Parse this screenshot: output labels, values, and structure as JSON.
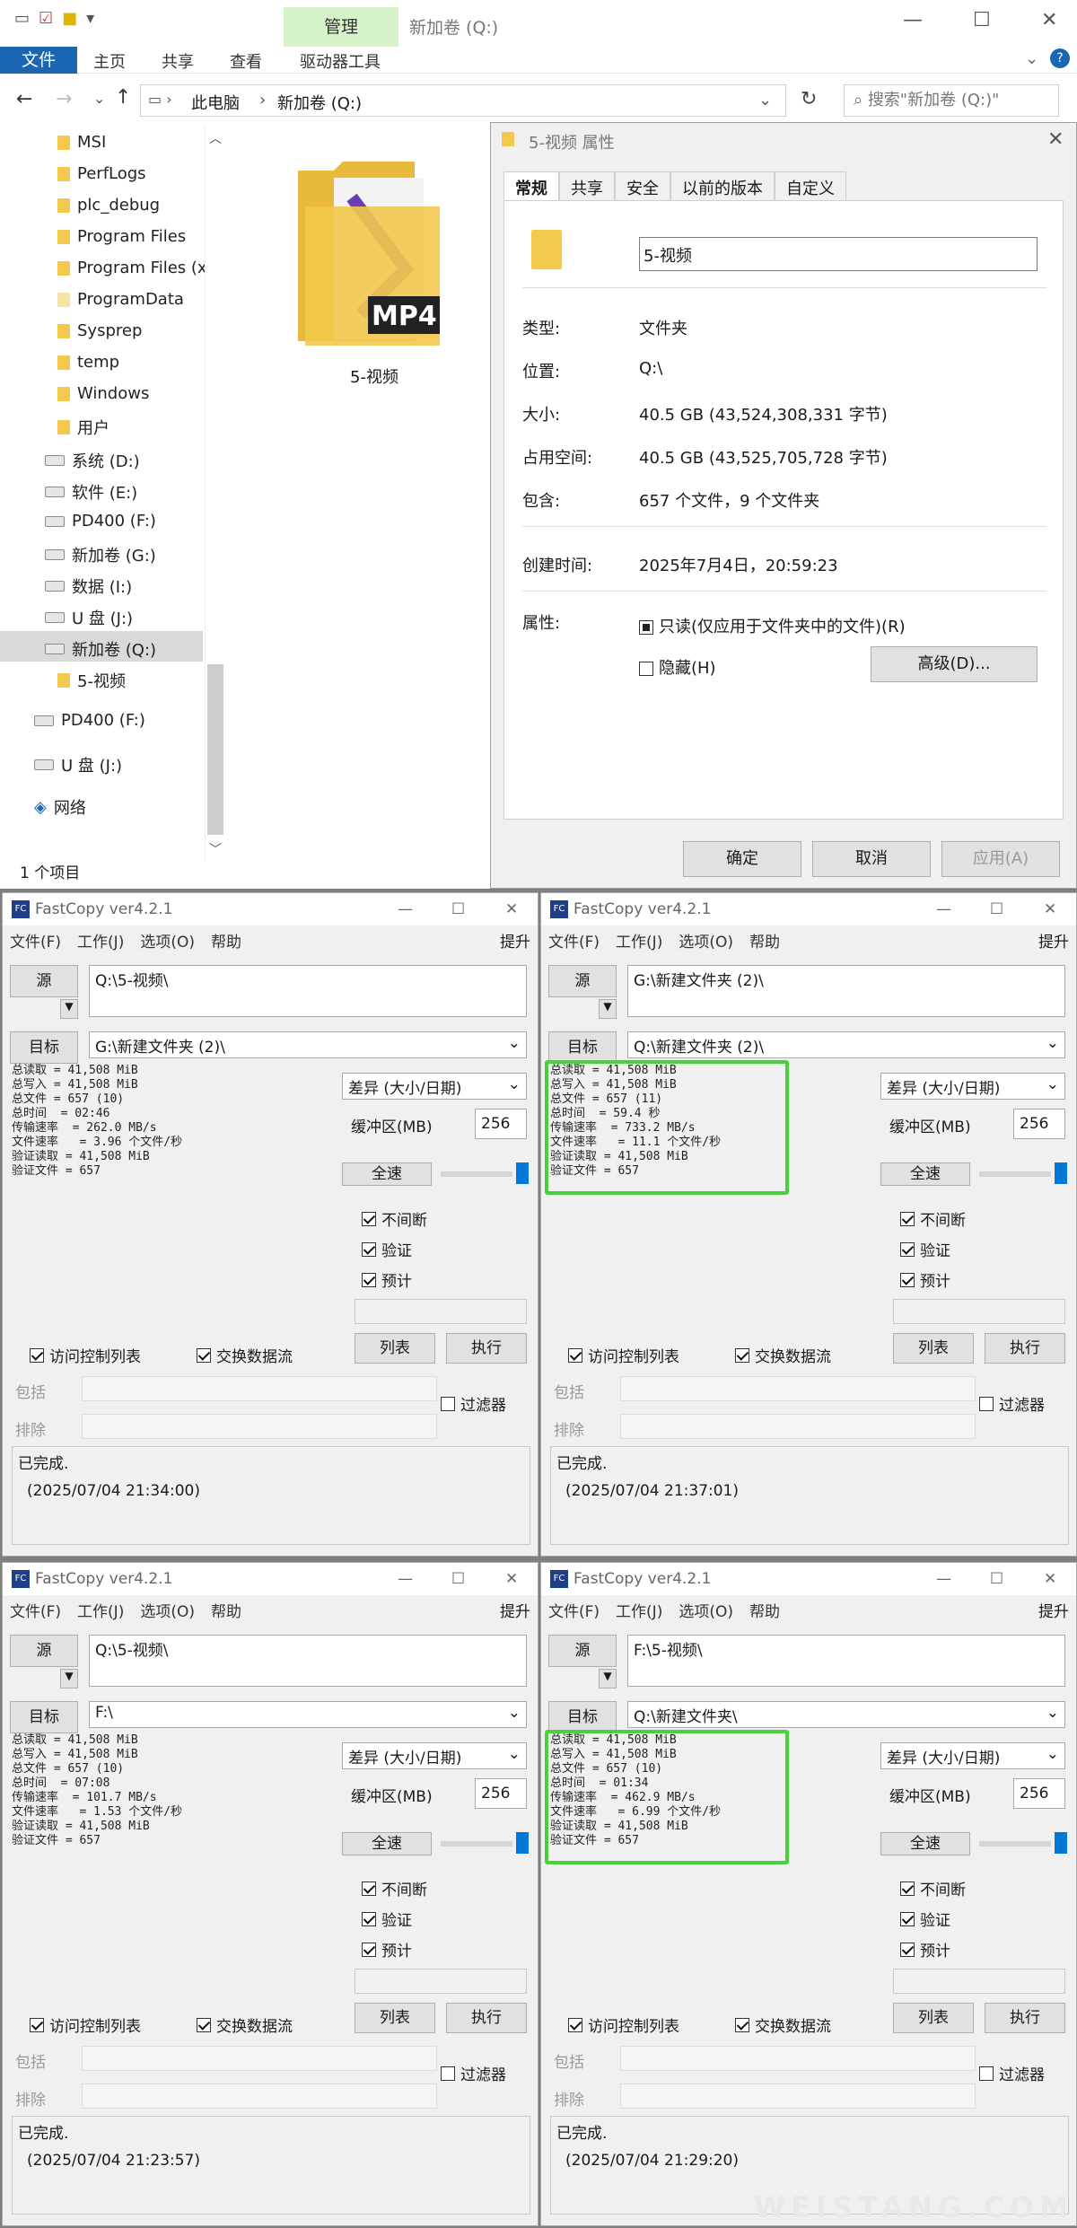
{
  "explorer": {
    "title": "新加卷 (Q:)",
    "manage_tab": "管理",
    "ribbon": {
      "file": "文件",
      "home": "主页",
      "share": "共享",
      "view": "查看",
      "drive_tools": "驱动器工具"
    },
    "breadcrumb": [
      "此电脑",
      "新加卷 (Q:)"
    ],
    "search_placeholder": "搜索\"新加卷 (Q:)\"",
    "nav_items": [
      "MSI",
      "PerfLogs",
      "plc_debug",
      "Program Files",
      "Program Files (x",
      "ProgramData",
      "Sysprep",
      "temp",
      "Windows",
      "用户",
      "系统 (D:)",
      "软件 (E:)",
      "PD400 (F:)",
      "新加卷 (G:)",
      "数据 (I:)",
      "U 盘 (J:)",
      "新加卷 (Q:)",
      "5-视频",
      "PD400 (F:)",
      "U 盘 (J:)",
      "网络"
    ],
    "folder_name": "5-视频",
    "mp4_label": "MP4",
    "status": "1 个项目"
  },
  "props": {
    "title": "5-视频 属性",
    "tabs": [
      "常规",
      "共享",
      "安全",
      "以前的版本",
      "自定义"
    ],
    "name_value": "5-视频",
    "type_label": "类型:",
    "type_value": "文件夹",
    "loc_label": "位置:",
    "loc_value": "Q:\\",
    "size_label": "大小:",
    "size_value": "40.5 GB (43,524,308,331 字节)",
    "disk_label": "占用空间:",
    "disk_value": "40.5 GB (43,525,705,728 字节)",
    "contains_label": "包含:",
    "contains_value": "657 个文件，9 个文件夹",
    "created_label": "创建时间:",
    "created_value": "2025年7月4日，20:59:23",
    "attr_label": "属性:",
    "readonly": "只读(仅应用于文件夹中的文件)(R)",
    "hidden": "隐藏(H)",
    "advanced": "高级(D)...",
    "ok": "确定",
    "cancel": "取消",
    "apply": "应用(A)"
  },
  "fastcopy": [
    {
      "title": "FastCopy ver4.2.1",
      "src": "Q:\\5-视频\\",
      "dst": "G:\\新建文件夹 (2)\\",
      "log": "总读取 = 41,508 MiB\n总写入 = 41,508 MiB\n总文件 = 657 (10)\n总时间  = 02:46\n传输速率  = 262.0 MB/s\n文件速率   = 3.96 个文件/秒\n验证读取 = 41,508 MiB\n验证文件 = 657",
      "done": "已完成.",
      "time": "(2025/07/04 21:34:00)",
      "highlight": false
    },
    {
      "title": "FastCopy ver4.2.1",
      "src": "G:\\新建文件夹 (2)\\",
      "dst": "Q:\\新建文件夹 (2)\\",
      "log": "总读取 = 41,508 MiB\n总写入 = 41,508 MiB\n总文件 = 657 (11)\n总时间  = 59.4 秒\n传输速率  = 733.2 MB/s\n文件速率   = 11.1 个文件/秒\n验证读取 = 41,508 MiB\n验证文件 = 657",
      "done": "已完成.",
      "time": "(2025/07/04 21:37:01)",
      "highlight": true
    },
    {
      "title": "FastCopy ver4.2.1",
      "src": "Q:\\5-视频\\",
      "dst": "F:\\",
      "log": "总读取 = 41,508 MiB\n总写入 = 41,508 MiB\n总文件 = 657 (10)\n总时间  = 07:08\n传输速率  = 101.7 MB/s\n文件速率   = 1.53 个文件/秒\n验证读取 = 41,508 MiB\n验证文件 = 657",
      "done": "已完成.",
      "time": "(2025/07/04 21:23:57)",
      "highlight": false
    },
    {
      "title": "FastCopy ver4.2.1",
      "src": "F:\\5-视频\\",
      "dst": "Q:\\新建文件夹\\",
      "log": "总读取 = 41,508 MiB\n总写入 = 41,508 MiB\n总文件 = 657 (10)\n总时间  = 01:34\n传输速率  = 462.9 MB/s\n文件速率   = 6.99 个文件/秒\n验证读取 = 41,508 MiB\n验证文件 = 657",
      "done": "已完成.",
      "time": "(2025/07/04 21:29:20)",
      "highlight": true
    }
  ],
  "fc_common": {
    "menu": [
      "文件(F)",
      "工作(J)",
      "选项(O)",
      "帮助"
    ],
    "upr": "提升",
    "src_btn": "源",
    "dst_btn": "目标",
    "mode": "差异 (大小/日期)",
    "buffer_label": "缓冲区(MB)",
    "buffer_value": "256",
    "fullspeed": "全速",
    "nonstop": "不间断",
    "verify": "验证",
    "estimate": "预计",
    "acl": "访问控制列表",
    "ads": "交换数据流",
    "list": "列表",
    "exec": "执行",
    "include": "包括",
    "exclude": "排除",
    "filter": "过滤器"
  },
  "watermark": "WEISTANG.COM"
}
